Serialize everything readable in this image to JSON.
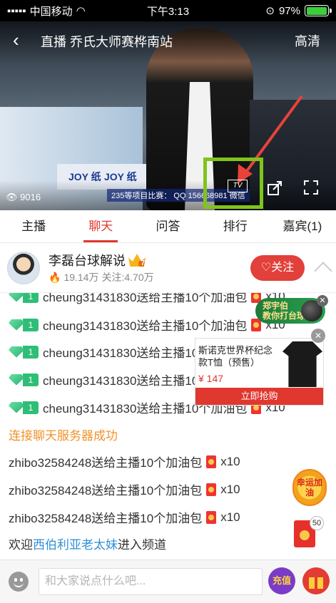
{
  "status_bar": {
    "carrier": "中国移动",
    "time": "下午3:13",
    "battery": "97%",
    "battery_level": 0.97
  },
  "video": {
    "title": "直播 乔氏大师赛桦南站",
    "quality": "高清",
    "viewer_count": "9016",
    "score_caption": "235等项目比赛：",
    "qq_text": "QQ 156668981 微信",
    "tv_label": "TV",
    "banner_words": [
      "JOY 纸",
      "JOY 纸"
    ]
  },
  "tabs": [
    "主播",
    "聊天",
    "问答",
    "排行",
    "嘉宾(1)"
  ],
  "active_tab": 1,
  "anchor": {
    "name": "李磊台球解说",
    "level": "7",
    "popularity": "19.14万",
    "following": "关注:4.70万",
    "follow_label": "关注"
  },
  "chat": {
    "gift_messages": [
      {
        "user": "cheung31431830",
        "text": "送给主播10个加油包",
        "count": "x10",
        "badge": "1"
      },
      {
        "user": "cheung31431830",
        "text": "送给主播10个加油包",
        "count": "x10",
        "badge": "1"
      },
      {
        "user": "cheung31431830",
        "text": "送给主播10个加油包",
        "count": "x10",
        "badge": "1"
      },
      {
        "user": "cheung31431830",
        "text": "送给主播10个加油包",
        "count": "x10",
        "badge": "1"
      },
      {
        "user": "cheung31431830",
        "text": "送给主播10个加油包",
        "count": "x10",
        "badge": "1"
      }
    ],
    "system_message": "连接聊天服务器成功",
    "user_messages": [
      {
        "user": "zhibo32584248",
        "text": "送给主播10个加油包",
        "count": "x10"
      },
      {
        "user": "zhibo32584248",
        "text": "送给主播10个加油包",
        "count": "x10"
      },
      {
        "user": "zhibo32584248",
        "text": "送给主播10个加油包",
        "count": "x10"
      }
    ],
    "welcome": {
      "prefix": "欢迎",
      "name": "西伯利亚老太妹",
      "suffix": "进入频道"
    }
  },
  "promo": {
    "float_line1": "郑宇伯",
    "float_line2": "教你打台球",
    "close": "✕"
  },
  "product": {
    "title": "斯诺克世界杯纪念款T恤（预售）",
    "price": "¥ 147",
    "buy_label": "立即抢购",
    "close": "✕"
  },
  "lucky": {
    "text": "幸运加油",
    "envelope_count": "50"
  },
  "input_bar": {
    "placeholder": "和大家说点什么吧...",
    "charge_label": "充值"
  }
}
